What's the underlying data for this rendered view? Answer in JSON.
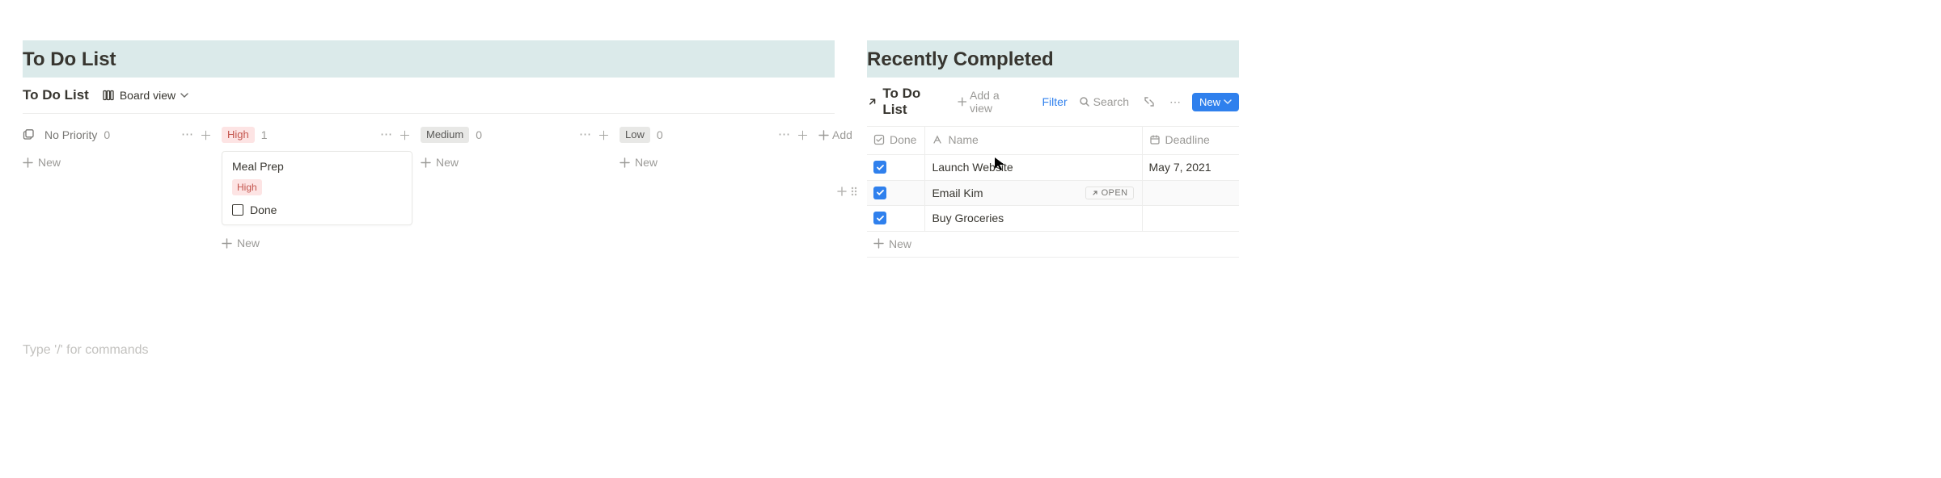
{
  "left": {
    "banner_title": "To Do List",
    "subheader_title": "To Do List",
    "view_label": "Board view",
    "add_col_label": "Add",
    "cmd_hint": "Type '/' for commands"
  },
  "board": {
    "new_label": "New",
    "columns": [
      {
        "key": "none",
        "label": "No Priority",
        "count": 0,
        "show_hover": true
      },
      {
        "key": "high",
        "label": "High",
        "count": 1,
        "show_hover": true
      },
      {
        "key": "medium",
        "label": "Medium",
        "count": 0,
        "show_hover": true
      },
      {
        "key": "low",
        "label": "Low",
        "count": 0,
        "show_hover": true
      }
    ],
    "high_card": {
      "title": "Meal Prep",
      "tag": "High",
      "done_label": "Done"
    }
  },
  "right": {
    "banner_title": "Recently Completed",
    "linked_title": "To Do List",
    "add_view_label": "Add a view",
    "filter_label": "Filter",
    "search_label": "Search",
    "new_label": "New",
    "headers": {
      "done": "Done",
      "name": "Name",
      "deadline": "Deadline"
    },
    "open_label": "OPEN",
    "table_new_label": "New",
    "rows": [
      {
        "done": true,
        "name": "Launch Website",
        "deadline": "May 7, 2021",
        "hover": false
      },
      {
        "done": true,
        "name": "Email Kim",
        "deadline": "",
        "hover": true
      },
      {
        "done": true,
        "name": "Buy Groceries",
        "deadline": "",
        "hover": false
      }
    ]
  }
}
